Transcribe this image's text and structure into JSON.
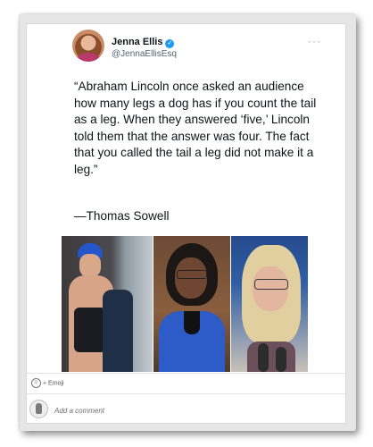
{
  "tweet": {
    "author_name": "Jenna Ellis",
    "verified_icon": "verified-badge-icon",
    "handle": "@JennaEllisEsq",
    "more_icon": "more-options-icon",
    "more_glyph": "···",
    "text": "“Abraham Lincoln once asked an audience how many legs a dog has if you count the tail as a leg. When they answered ‘five,’ Lincoln told them that the answer was four. The fact that you called the tail a leg did not make it a leg.”",
    "attribution": "—Thomas Sowell"
  },
  "photos": {
    "count": 3
  },
  "footer": {
    "emoji_icon": "emoji-icon",
    "emoji_label": "Emoji",
    "comment_placeholder": "Add a comment"
  },
  "colors": {
    "verified": "#1d9bf0",
    "text": "#0f1419",
    "handle": "#536471"
  }
}
